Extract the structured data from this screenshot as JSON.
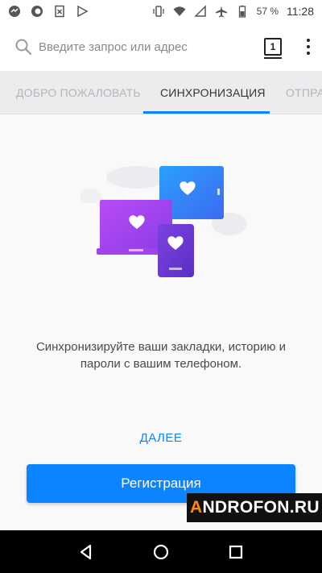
{
  "status_bar": {
    "battery": "57 %",
    "time": "11:28",
    "left_icons": [
      "messenger-icon",
      "firefox-icon",
      "file-icon",
      "play-store-icon"
    ],
    "right_icons": [
      "vibrate-icon",
      "wifi-icon",
      "no-sim-icon",
      "airplane-icon",
      "battery-icon"
    ]
  },
  "toolbar": {
    "search_placeholder": "Введите запрос или адрес",
    "tab_count": "1"
  },
  "tabs": [
    {
      "label": "ДОБРО ПОЖАЛОВАТЬ",
      "active": false
    },
    {
      "label": "СИНХРОНИЗАЦИЯ",
      "active": true
    },
    {
      "label": "ОТПРА",
      "active": false
    }
  ],
  "content": {
    "description": "Синхронизируйте ваши закладки, историю и пароли с вашим телефоном.",
    "next_label": "ДАЛЕЕ",
    "register_label": "Регистрация"
  },
  "watermark": {
    "text_a": "A",
    "text_rest": "NDROFON.RU"
  },
  "colors": {
    "accent": "#0a84ff",
    "tab_active": "#333333",
    "tab_inactive": "#b5b5b8"
  }
}
